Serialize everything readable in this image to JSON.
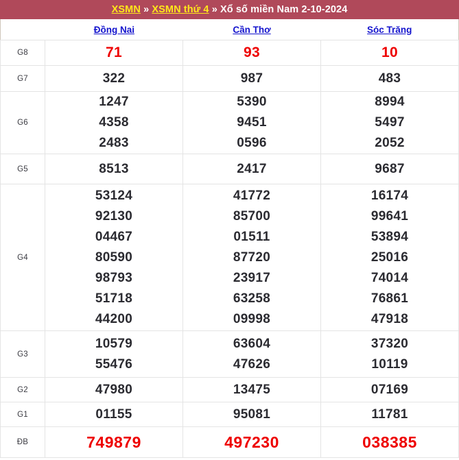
{
  "header": {
    "link1": "XSMN",
    "sep1": "»",
    "link2": "XSMN thứ 4",
    "sep2": "»",
    "tail": "Xổ số miền Nam 2-10-2024",
    "background_color": "#b0495a",
    "link_color": "#ffe81a",
    "text_color": "#ffffff"
  },
  "provinces": [
    {
      "name": "Đồng Nai"
    },
    {
      "name": "Cần Thơ"
    },
    {
      "name": "Sóc Trăng"
    }
  ],
  "colors": {
    "highlight_red": "#ee0000",
    "number_dark": "#2b2b31",
    "province_blue": "#1414cd",
    "grid_line": "#e4e4e4",
    "outer_border": "#cfc6bb"
  },
  "prizes": [
    {
      "label": "G8",
      "highlight": true,
      "values": [
        [
          "71"
        ],
        [
          "93"
        ],
        [
          "10"
        ]
      ]
    },
    {
      "label": "G7",
      "highlight": false,
      "values": [
        [
          "322"
        ],
        [
          "987"
        ],
        [
          "483"
        ]
      ]
    },
    {
      "label": "G6",
      "highlight": false,
      "values": [
        [
          "1247",
          "4358",
          "2483"
        ],
        [
          "5390",
          "9451",
          "0596"
        ],
        [
          "8994",
          "5497",
          "2052"
        ]
      ]
    },
    {
      "label": "G5",
      "highlight": false,
      "values": [
        [
          "8513"
        ],
        [
          "2417"
        ],
        [
          "9687"
        ]
      ]
    },
    {
      "label": "G4",
      "highlight": false,
      "values": [
        [
          "53124",
          "92130",
          "04467",
          "80590",
          "98793",
          "51718",
          "44200"
        ],
        [
          "41772",
          "85700",
          "01511",
          "87720",
          "23917",
          "63258",
          "09998"
        ],
        [
          "16174",
          "99641",
          "53894",
          "25016",
          "74014",
          "76861",
          "47918"
        ]
      ]
    },
    {
      "label": "G3",
      "highlight": false,
      "values": [
        [
          "10579",
          "55476"
        ],
        [
          "63604",
          "47626"
        ],
        [
          "37320",
          "10119"
        ]
      ]
    },
    {
      "label": "G2",
      "highlight": false,
      "values": [
        [
          "47980"
        ],
        [
          "13475"
        ],
        [
          "07169"
        ]
      ]
    },
    {
      "label": "G1",
      "highlight": false,
      "values": [
        [
          "01155"
        ],
        [
          "95081"
        ],
        [
          "11781"
        ]
      ]
    },
    {
      "label": "ĐB",
      "highlight": true,
      "values": [
        [
          "749879"
        ],
        [
          "497230"
        ],
        [
          "038385"
        ]
      ]
    }
  ]
}
